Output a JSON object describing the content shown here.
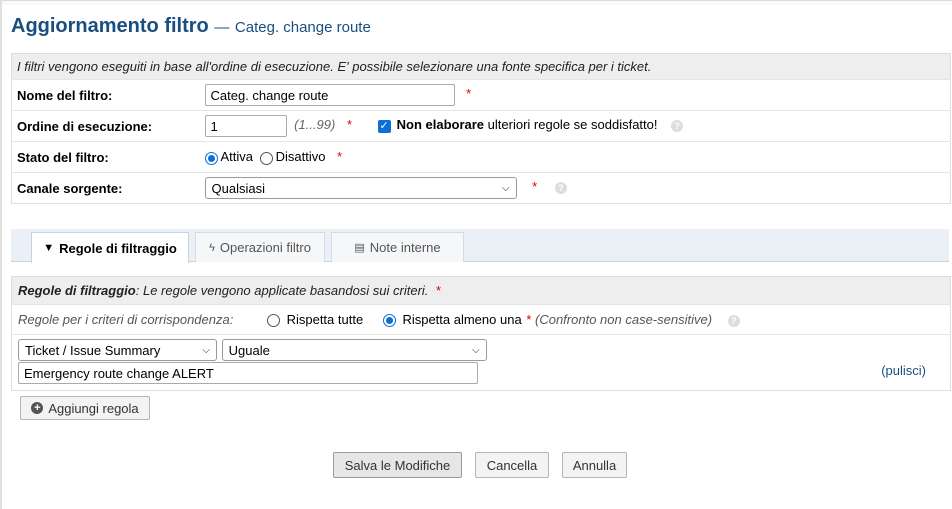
{
  "header": {
    "title": "Aggiornamento filtro",
    "dash": "—",
    "subtitle": "Categ. change route"
  },
  "form": {
    "info": "I filtri vengono eseguiti in base all'ordine di esecuzione. E' possibile selezionare una fonte specifica per i ticket.",
    "name_label": "Nome del filtro:",
    "name_value": "Categ. change route",
    "order_label": "Ordine di esecuzione:",
    "order_value": "1",
    "order_hint": "(1...99)",
    "stop_bold": "Non elaborare",
    "stop_rest": "ulteriori regole se soddisfatto!",
    "state_label": "Stato del filtro:",
    "state_active": "Attiva",
    "state_inactive": "Disattivo",
    "channel_label": "Canale sorgente:",
    "channel_value": "Qualsiasi",
    "required": "*",
    "help": "?"
  },
  "tabs": [
    {
      "label": "Regole di filtraggio",
      "icon": "▼"
    },
    {
      "label": "Operazioni filtro",
      "icon": "ϟ"
    },
    {
      "label": "Note interne",
      "icon": "▤"
    }
  ],
  "rules": {
    "head_bold": "Regole di filtraggio",
    "head_rest": ": Le regole vengono applicate basandosi sui criteri.",
    "match_label": "Regole per i criteri di corrispondenza:",
    "match_all": "Rispetta tutte",
    "match_any": "Rispetta almeno una",
    "case_note": "(Confronto non case-sensitive)",
    "field_value": "Ticket / Issue Summary",
    "operator_value": "Uguale",
    "rule_value": "Emergency route change ALERT",
    "clear_label": "(pulisci)",
    "add_rule": "Aggiungi regola"
  },
  "buttons": {
    "save": "Salva le Modifiche",
    "reset": "Cancella",
    "cancel": "Annulla"
  }
}
